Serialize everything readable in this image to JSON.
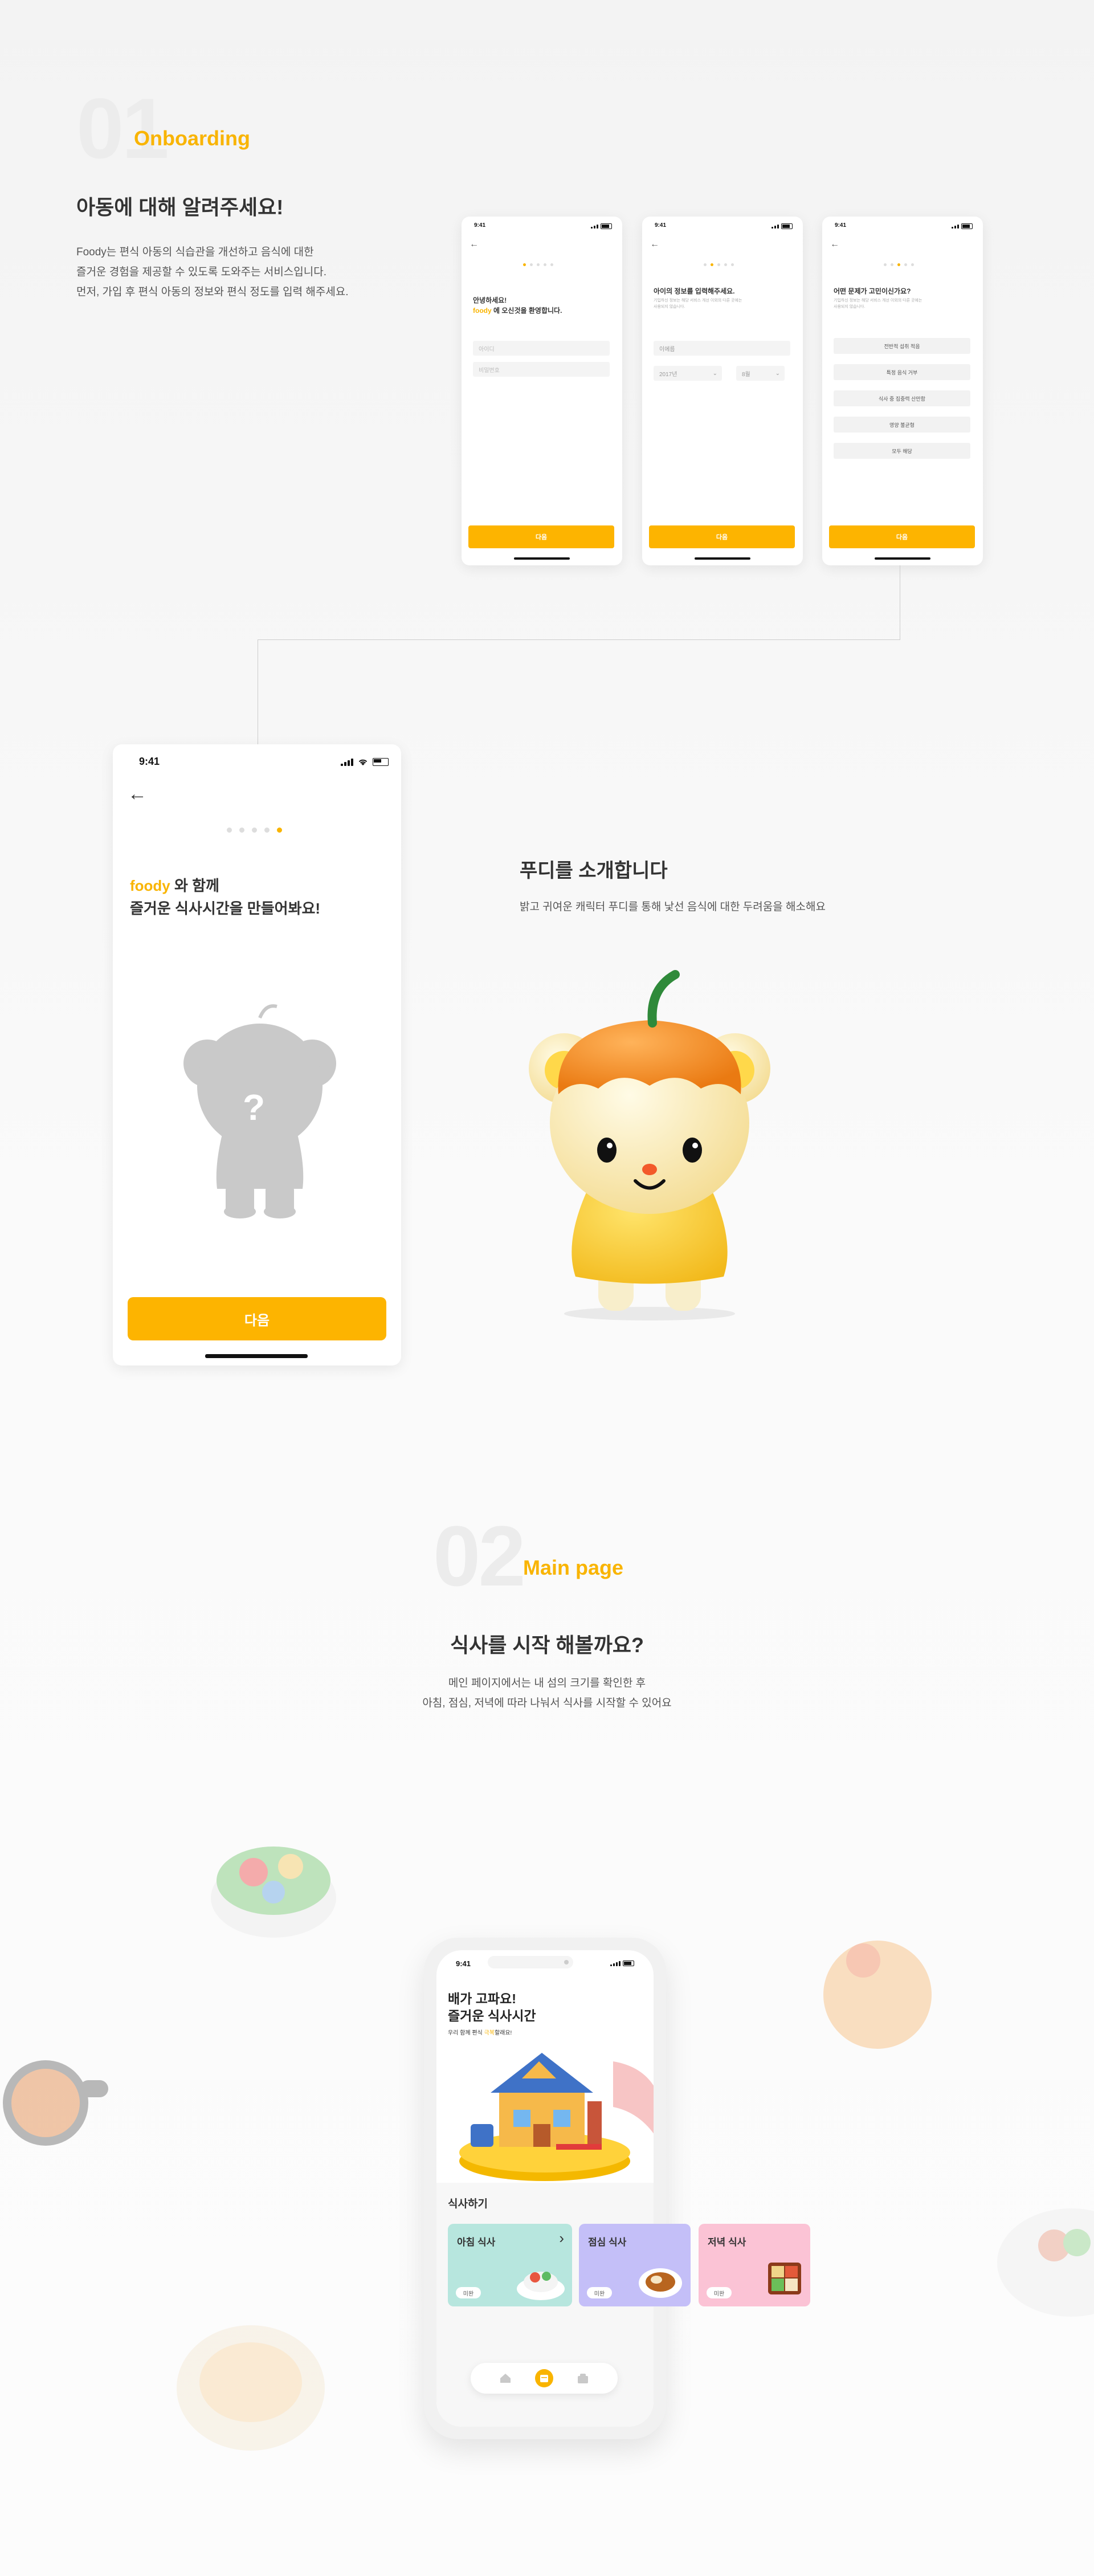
{
  "section1": {
    "number": "01",
    "title": "Onboarding",
    "heading": "아동에 대해 알려주세요!",
    "desc": [
      "Foody는 편식 아동의 식습관을 개선하고 음식에 대한",
      "즐거운 경험을 제공할 수 있도록 도와주는 서비스입니다.",
      "먼저, 가입 후 편식 아동의 정보와 편식 정도를 입력 해주세요."
    ]
  },
  "status_time": "9:41",
  "screen1": {
    "greeting": "안녕하세요!",
    "brand": "foody",
    "welcome": " 에 오신것을 환영합니다.",
    "field1_placeholder": "아이디",
    "field2_placeholder": "비밀번호",
    "next": "다음"
  },
  "screen2": {
    "title": "아이의 정보를 입력해주세요.",
    "sub1": "기입하신 정보는 해당 서비스 개선 이외의 다른 곳에는",
    "sub2": "사용되지 않습니다.",
    "name_placeholder": "이에름",
    "year": "2017년",
    "month": "8월",
    "next": "다음"
  },
  "screen3": {
    "title": "어떤 문제가 고민이신가요?",
    "sub1": "기입하신 정보는 해당 서비스 개선 이외의 다른 곳에는",
    "sub2": "사용되지 않습니다.",
    "choices": [
      "전반적 섭취 적음",
      "특정 음식 거부",
      "식사 중 집중력 산만함",
      "영양 불균형",
      "모두 해당"
    ],
    "next": "다음"
  },
  "screen4": {
    "brand": "foody",
    "line1_rest": " 와 함께",
    "line2": "즐거운 식사시간을 만들어봐요!",
    "question_mark": "?",
    "next": "다음"
  },
  "intro": {
    "heading": "푸디를 소개합니다",
    "desc": "밝고 귀여운 캐릭터 푸디를 통해 낯선 음식에 대한 두려움을 해소해요"
  },
  "section2": {
    "number": "02",
    "title": "Main page",
    "heading": "식사를 시작 해볼까요?",
    "desc": [
      "메인 페이지에서는 내 섬의 크기를 확인한 후",
      "아침, 점심, 저녁에 따라 나눠서 식사를 시작할 수 있어요"
    ]
  },
  "main_phone": {
    "headline1": "배가 고파요!",
    "headline2": "즐거운 식사시간",
    "sub_pre": "우리 함께 편식 ",
    "sub_hl": "극복",
    "sub_post": "할래요!",
    "meal_section": "식사하기",
    "meals": [
      {
        "name": "아침 식사",
        "badge": "미완",
        "color": "#b7e6de"
      },
      {
        "name": "점심 식사",
        "badge": "미완",
        "color": "#c4bff8"
      },
      {
        "name": "저녁 식사",
        "badge": "미완",
        "color": "#fbc3d5"
      }
    ],
    "chevron": "›"
  },
  "colors": {
    "accent": "#f9b400",
    "button": "#fdb400"
  }
}
